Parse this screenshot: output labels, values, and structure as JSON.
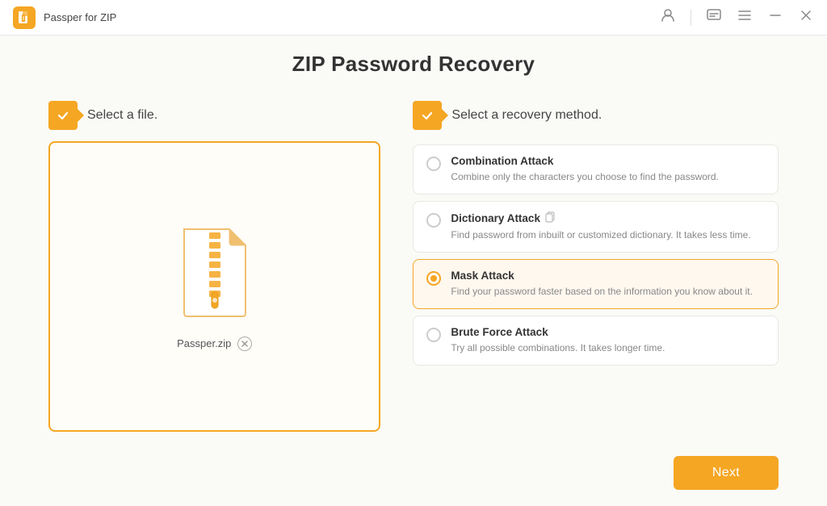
{
  "titleBar": {
    "appName": "Passper for ZIP",
    "icons": {
      "account": "👤",
      "message": "💬",
      "menu": "☰",
      "minimize": "—",
      "close": "✕"
    }
  },
  "page": {
    "title": "ZIP Password Recovery"
  },
  "leftPanel": {
    "stepLabel": "Select a file.",
    "fileName": "Passper.zip"
  },
  "rightPanel": {
    "stepLabel": "Select a recovery method.",
    "methods": [
      {
        "id": "combination",
        "name": "Combination Attack",
        "description": "Combine only the characters you choose to find the password.",
        "selected": false,
        "hasIcon": false
      },
      {
        "id": "dictionary",
        "name": "Dictionary Attack",
        "description": "Find password from inbuilt or customized dictionary. It takes less time.",
        "selected": false,
        "hasIcon": true
      },
      {
        "id": "mask",
        "name": "Mask Attack",
        "description": "Find your password faster based on the information you know about it.",
        "selected": true,
        "hasIcon": false
      },
      {
        "id": "brute",
        "name": "Brute Force Attack",
        "description": "Try all possible combinations. It takes longer time.",
        "selected": false,
        "hasIcon": false
      }
    ]
  },
  "footer": {
    "nextButton": "Next"
  }
}
